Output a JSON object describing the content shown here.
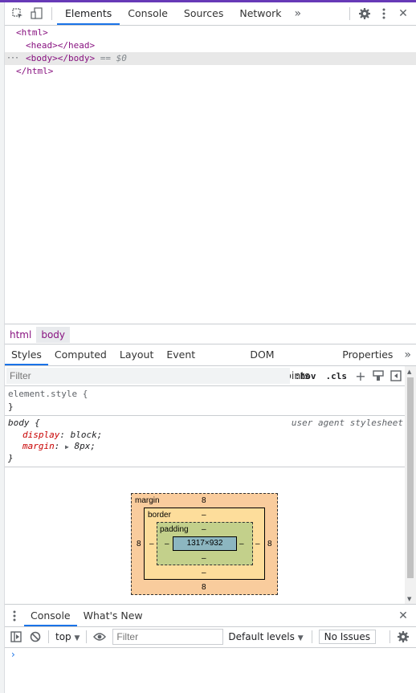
{
  "toolbar": {
    "tabs": [
      "Elements",
      "Console",
      "Sources",
      "Network"
    ],
    "more": "»",
    "close": "✕"
  },
  "dom": {
    "lines": [
      "<html>",
      "<head></head>",
      "<body></body>",
      "</html>"
    ],
    "selected_marker": "== $0",
    "dots": "···"
  },
  "breadcrumbs": [
    "html",
    "body"
  ],
  "style_tabs": [
    "Styles",
    "Computed",
    "Layout",
    "Event Listeners",
    "DOM Breakpoints",
    "Properties"
  ],
  "style_tabs_more": "»",
  "filter": {
    "placeholder": "Filter",
    "hov": ":hov",
    "cls": ".cls",
    "plus": "+"
  },
  "rules": {
    "element_style": "element.style {",
    "close": "}",
    "body_selector": "body {",
    "ua_label": "user agent stylesheet",
    "props": [
      {
        "name": "display",
        "value": "block;"
      },
      {
        "name": "margin",
        "value": "8px;"
      }
    ]
  },
  "box_model": {
    "margin_label": "margin",
    "border_label": "border",
    "padding_label": "padding",
    "margin_top": "8",
    "margin_bottom": "8",
    "margin_left": "8",
    "margin_right": "8",
    "border_top": "–",
    "border_bottom": "–",
    "border_left": "–",
    "border_right": "–",
    "padding_top": "–",
    "padding_bottom": "–",
    "padding_left": "–",
    "padding_right": "–",
    "content": "1317×932"
  },
  "drawer": {
    "tabs": [
      "Console",
      "What's New"
    ],
    "close": "✕",
    "context": "top",
    "filter_placeholder": "Filter",
    "levels": "Default levels",
    "issues": "No Issues",
    "prompt": "›"
  },
  "colors": {
    "accent": "#1a73e8",
    "tag": "#881280",
    "prop": "#c80000",
    "margin_box": "#f9cc9d",
    "border_box": "#fddd9b",
    "padding_box": "#c3d08b",
    "content_box": "#8cb6c0"
  },
  "icons": [
    "inspect-icon",
    "device-toolbar-icon",
    "gear-icon",
    "kebab-menu-icon",
    "close-icon",
    "new-style-rule-icon",
    "toggle-element-state-icon",
    "computed-sidebar-icon",
    "drawer-menu-icon",
    "sidebar-toggle-icon",
    "clear-console-icon",
    "eye-icon"
  ]
}
